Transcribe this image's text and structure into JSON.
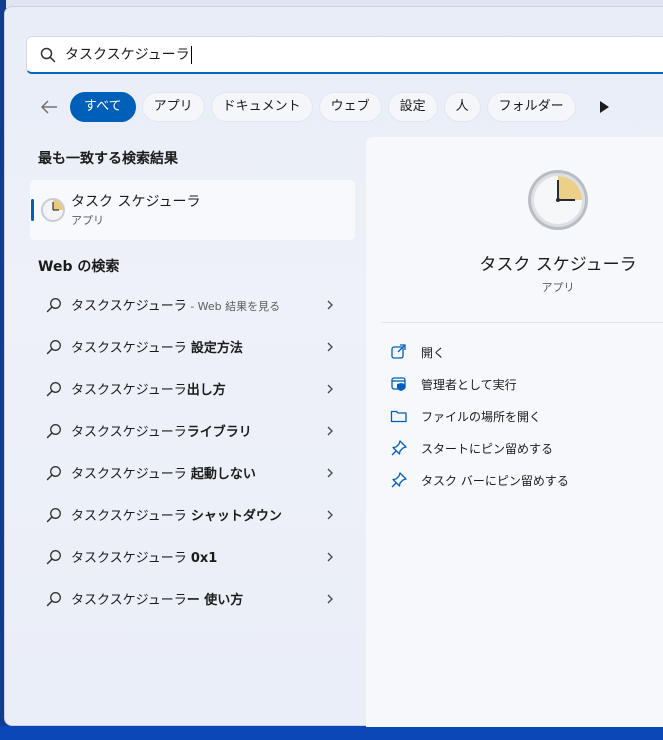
{
  "search": {
    "query": "タスクスケジューラ"
  },
  "filters": {
    "chips": [
      "すべて",
      "アプリ",
      "ドキュメント",
      "ウェブ",
      "設定",
      "人",
      "フォルダー"
    ]
  },
  "best_match": {
    "title": "最も一致する検索結果",
    "app_name": "タスク スケジューラ",
    "app_type": "アプリ"
  },
  "web": {
    "title": "Web の検索",
    "items": [
      {
        "base": "タスクスケジューラ",
        "suffix": "",
        "hint": " - Web 結果を見る"
      },
      {
        "base": "タスクスケジューラ ",
        "suffix": "設定方法",
        "hint": ""
      },
      {
        "base": "タスクスケジューラ",
        "suffix": "出し方",
        "hint": ""
      },
      {
        "base": "タスクスケジューラ",
        "suffix": "ライブラリ",
        "hint": ""
      },
      {
        "base": "タスクスケジューラ ",
        "suffix": "起動しない",
        "hint": ""
      },
      {
        "base": "タスクスケジューラ ",
        "suffix": "シャットダウン",
        "hint": ""
      },
      {
        "base": "タスクスケジューラ ",
        "suffix": "0x1",
        "hint": ""
      },
      {
        "base": "タスクスケジューラ",
        "suffix": "ー 使い方",
        "hint": ""
      }
    ]
  },
  "detail": {
    "app_name": "タスク スケジューラ",
    "app_type": "アプリ",
    "actions": [
      {
        "label": "開く",
        "icon": "open-icon"
      },
      {
        "label": "管理者として実行",
        "icon": "run-as-admin-icon"
      },
      {
        "label": "ファイルの場所を開く",
        "icon": "folder-icon"
      },
      {
        "label": "スタートにピン留めする",
        "icon": "pin-icon"
      },
      {
        "label": "タスク バーにピン留めする",
        "icon": "pin-icon"
      }
    ]
  },
  "colors": {
    "accent": "#005fb8",
    "desktop": "#0a3f9e"
  }
}
